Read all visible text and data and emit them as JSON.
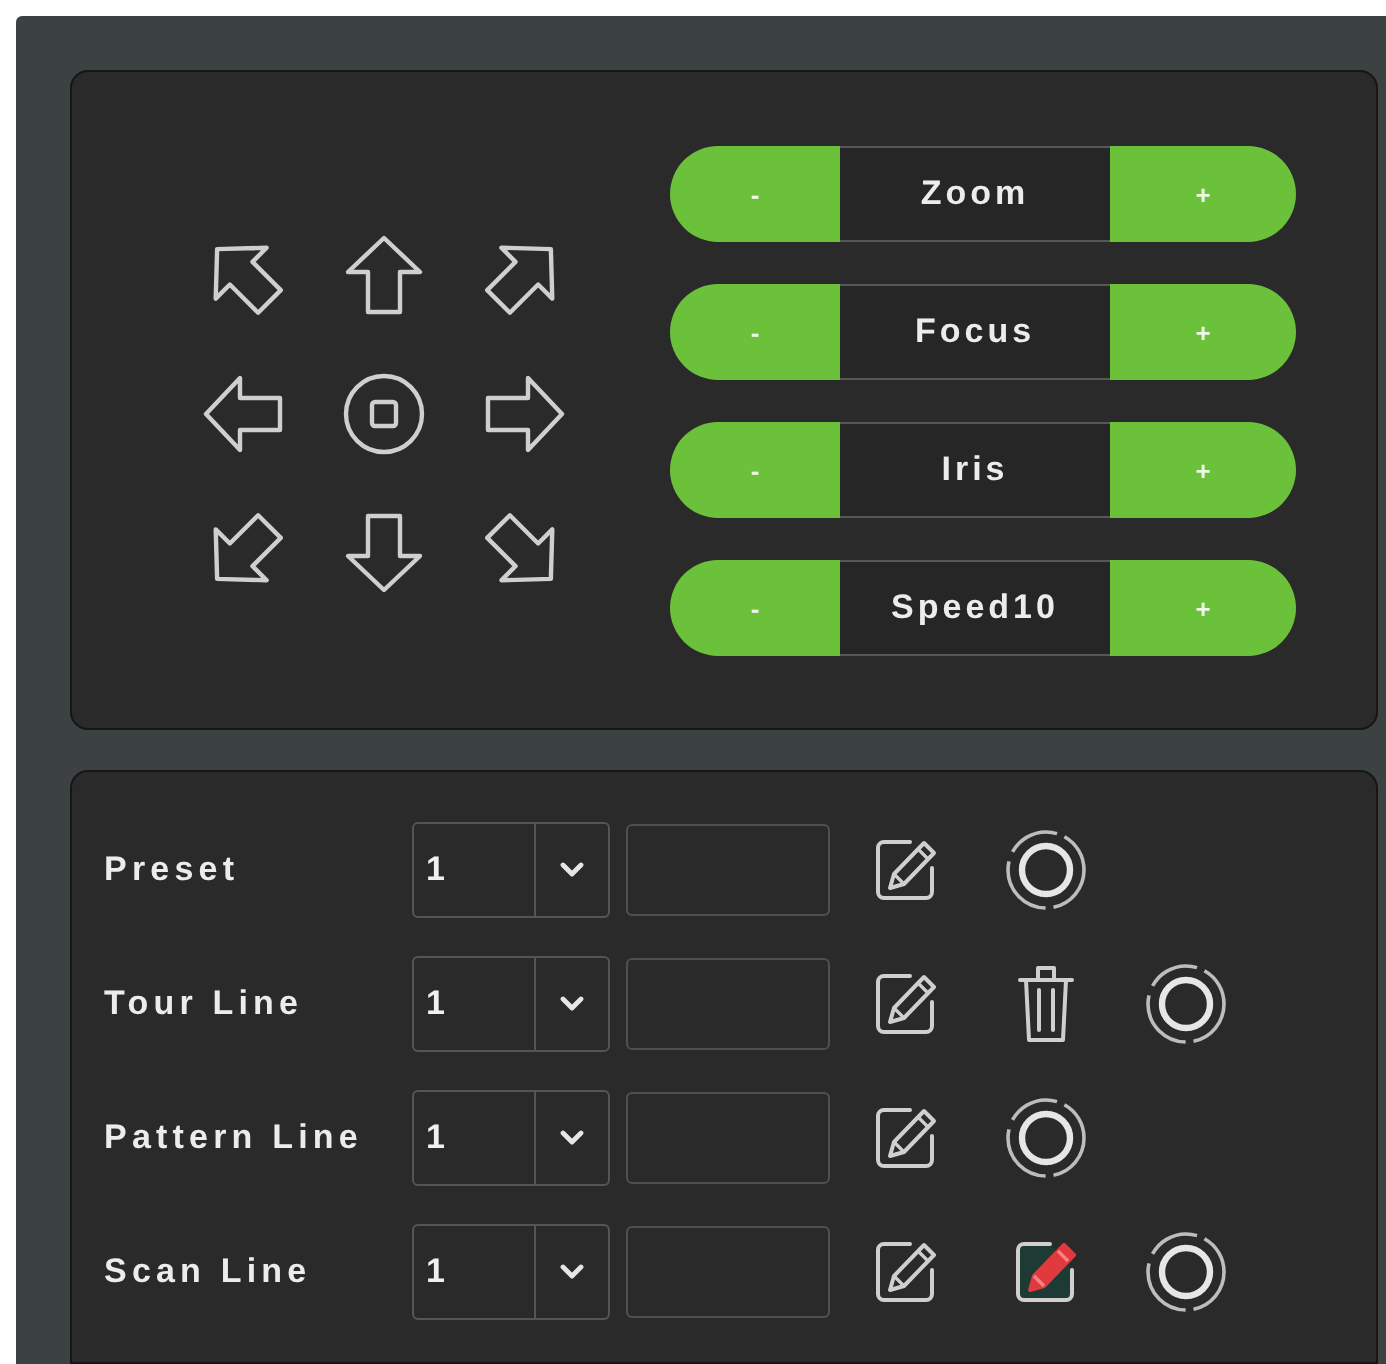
{
  "ptz_panel": {
    "lens_controls": [
      {
        "label": "Zoom",
        "minus": "-",
        "plus": "+"
      },
      {
        "label": "Focus",
        "minus": "-",
        "plus": "+"
      },
      {
        "label": "Iris",
        "minus": "-",
        "plus": "+"
      },
      {
        "label": "Speed10",
        "minus": "-",
        "plus": "+"
      }
    ]
  },
  "presets_panel": {
    "rows": [
      {
        "label": "Preset",
        "value": "1",
        "actions": [
          {
            "kind": "edit",
            "highlighted": false
          },
          {
            "kind": "run",
            "highlighted": false
          }
        ]
      },
      {
        "label": "Tour Line",
        "value": "1",
        "actions": [
          {
            "kind": "edit",
            "highlighted": false
          },
          {
            "kind": "delete",
            "highlighted": false
          },
          {
            "kind": "run",
            "highlighted": false
          }
        ]
      },
      {
        "label": "Pattern Line",
        "value": "1",
        "actions": [
          {
            "kind": "edit",
            "highlighted": false
          },
          {
            "kind": "run",
            "highlighted": false
          }
        ]
      },
      {
        "label": "Scan Line",
        "value": "1",
        "actions": [
          {
            "kind": "edit",
            "highlighted": false
          },
          {
            "kind": "edit",
            "highlighted": true
          },
          {
            "kind": "run",
            "highlighted": false
          }
        ]
      }
    ]
  }
}
